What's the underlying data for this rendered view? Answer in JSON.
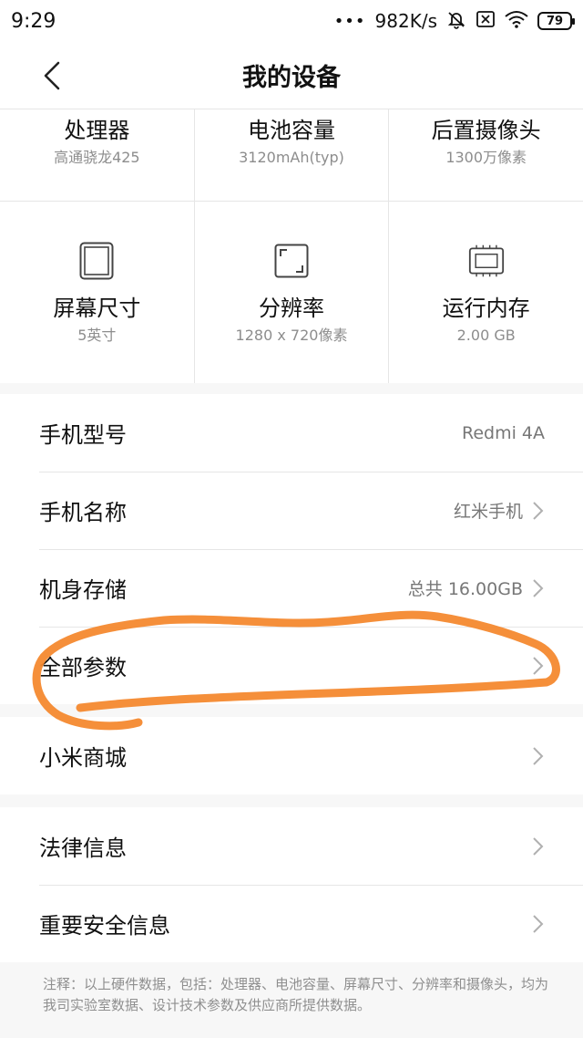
{
  "status_bar": {
    "time": "9:29",
    "dots": "•••",
    "speed": "982K/s",
    "battery": "79",
    "icons": [
      "bell-off-icon",
      "sim-x-icon",
      "wifi-icon",
      "battery-icon"
    ]
  },
  "header": {
    "title": "我的设备",
    "back_icon": "chevron-left-icon"
  },
  "specs": {
    "top": [
      {
        "title": "处理器",
        "sub": "高通骁龙425"
      },
      {
        "title": "电池容量",
        "sub": "3120mAh(typ)"
      },
      {
        "title": "后置摄像头",
        "sub": "1300万像素"
      }
    ],
    "bottom": [
      {
        "title": "屏幕尺寸",
        "sub": "5英寸",
        "icon": "screen-icon"
      },
      {
        "title": "分辨率",
        "sub": "1280 x 720像素",
        "icon": "resolution-icon"
      },
      {
        "title": "运行内存",
        "sub": "2.00 GB",
        "icon": "memory-chip-icon"
      }
    ]
  },
  "group1": [
    {
      "label": "手机型号",
      "value": "Redmi 4A"
    },
    {
      "label": "手机名称",
      "value": "红米手机"
    },
    {
      "label": "机身存储",
      "value": "总共 16.00GB"
    },
    {
      "label": "全部参数",
      "value": ""
    }
  ],
  "group2": [
    {
      "label": "小米商城"
    }
  ],
  "group3": [
    {
      "label": "法律信息"
    },
    {
      "label": "重要安全信息"
    }
  ],
  "footer": {
    "note": "注释：以上硬件数据，包括：处理器、电池容量、屏幕尺寸、分辨率和摄像头，均为我司实验室数据、设计技术参数及供应商所提供数据。"
  },
  "colors": {
    "annotation": "#f4892f",
    "divider": "#e6e6e6",
    "secondary_text": "#8d8d8d"
  }
}
